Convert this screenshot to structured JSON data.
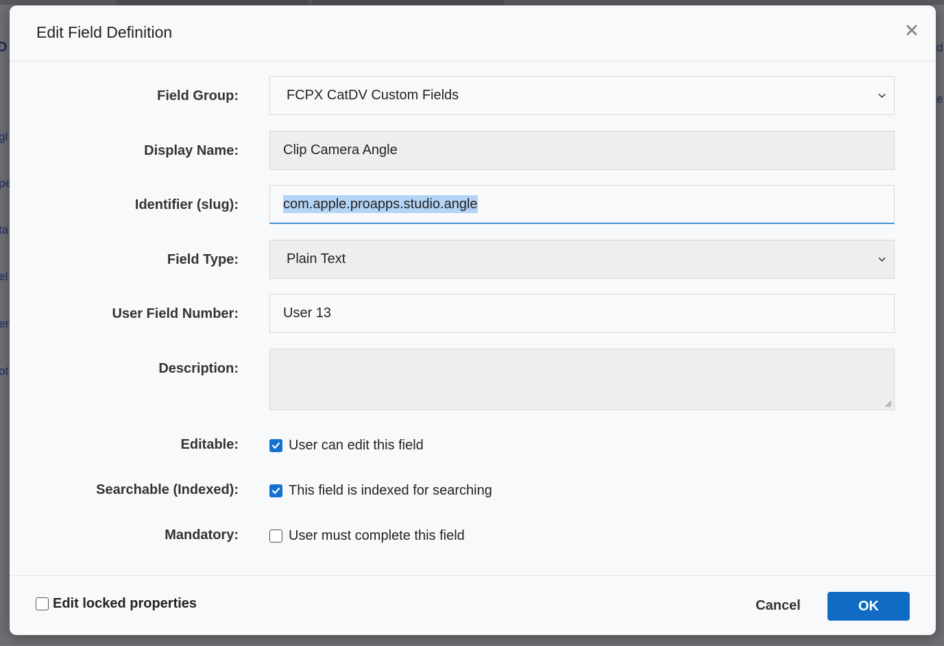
{
  "dialog": {
    "title": "Edit Field Definition",
    "close_label": "×"
  },
  "form": {
    "field_group": {
      "label": "Field Group:",
      "value": "FCPX CatDV Custom Fields"
    },
    "display_name": {
      "label": "Display Name:",
      "value": "Clip Camera Angle"
    },
    "identifier": {
      "label": "Identifier (slug):",
      "value": "com.apple.proapps.studio.angle"
    },
    "field_type": {
      "label": "Field Type:",
      "value": "Plain Text"
    },
    "user_field_number": {
      "label": "User Field Number:",
      "value": "User 13"
    },
    "description": {
      "label": "Description:",
      "value": ""
    },
    "editable": {
      "label": "Editable:",
      "checkbox_label": "User can edit this field",
      "checked": true
    },
    "searchable": {
      "label": "Searchable (Indexed):",
      "checkbox_label": "This field is indexed for searching",
      "checked": true
    },
    "mandatory": {
      "label": "Mandatory:",
      "checkbox_label": "User must complete this field",
      "checked": false
    }
  },
  "footer": {
    "edit_locked_label": "Edit locked properties",
    "edit_locked_checked": false,
    "cancel_label": "Cancel",
    "ok_label": "OK"
  },
  "background_fragments": [
    "D",
    "gl",
    "pe",
    "ta",
    "el",
    "er",
    "ot",
    "d",
    "e"
  ],
  "colors": {
    "accent": "#0f6cc2",
    "checkbox_on": "#1670d2",
    "focus_underline": "#3d8fd6",
    "selection": "#b3d4f5"
  }
}
